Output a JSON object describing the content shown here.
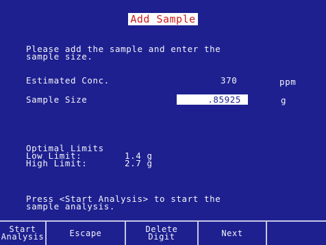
{
  "title": "Add Sample",
  "instructions": {
    "line1": "Please add the sample and enter the",
    "line2": "sample size."
  },
  "estimated": {
    "label": "Estimated Conc.",
    "value": "370",
    "unit": "ppm"
  },
  "sample_size": {
    "label": "Sample Size",
    "value": ".85925",
    "unit": "g"
  },
  "limits": {
    "heading": "Optimal Limits",
    "low_label": "Low Limit:",
    "low_value": "1.4 g",
    "high_label": "High Limit:",
    "high_value": "2.7 g"
  },
  "prompt": {
    "line1": "Press <Start Analysis> to start the",
    "line2": "sample analysis."
  },
  "softkeys": [
    {
      "label": "Start\nAnalysis"
    },
    {
      "label": "Escape"
    },
    {
      "label": "Delete\nDigit"
    },
    {
      "label": "Next"
    },
    {
      "label": ""
    }
  ],
  "colors": {
    "background": "#1e2090",
    "title_text": "#cc1a1a",
    "highlight": "#ffffff"
  }
}
